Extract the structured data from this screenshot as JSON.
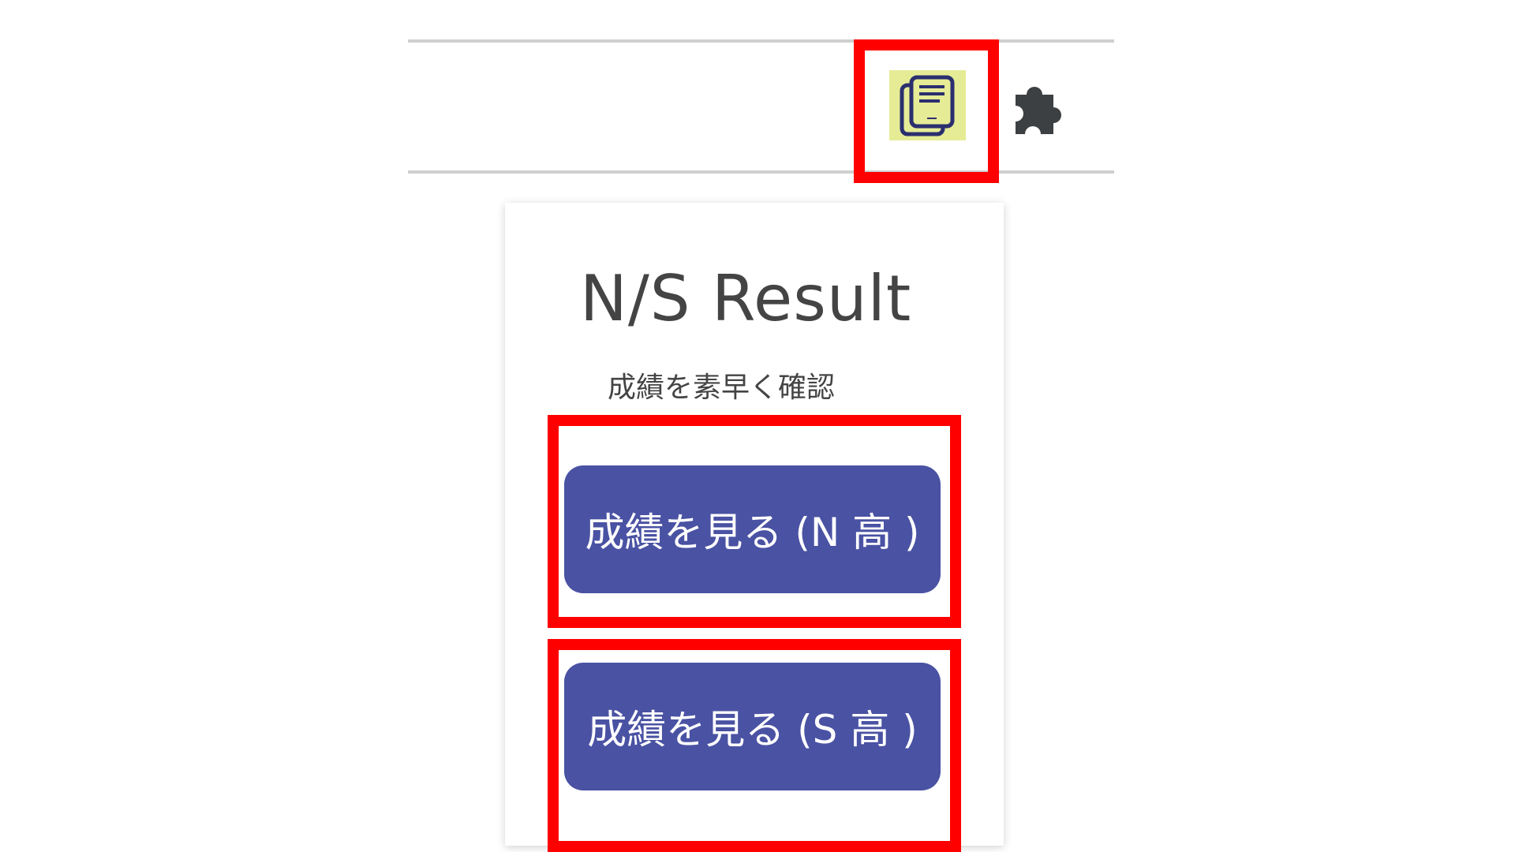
{
  "toolbar": {
    "extension_icon": "ns-result-extension-icon",
    "puzzle_icon": "extensions-puzzle-icon",
    "colors": {
      "extension_icon_bg": "#e6ec96",
      "extension_icon_fg": "#2b2f6e",
      "puzzle": "#3c4043"
    }
  },
  "popup": {
    "title": "N/S Result",
    "subtitle": "成績を素早く確認",
    "buttons": {
      "n_label": "成績を見る (N 高 )",
      "s_label": "成績を見る (S 高 )"
    },
    "colors": {
      "button_bg": "#4a52a3",
      "button_text": "#ffffff",
      "text": "#444444"
    }
  },
  "annotations": {
    "highlight_color": "#ff0000"
  }
}
